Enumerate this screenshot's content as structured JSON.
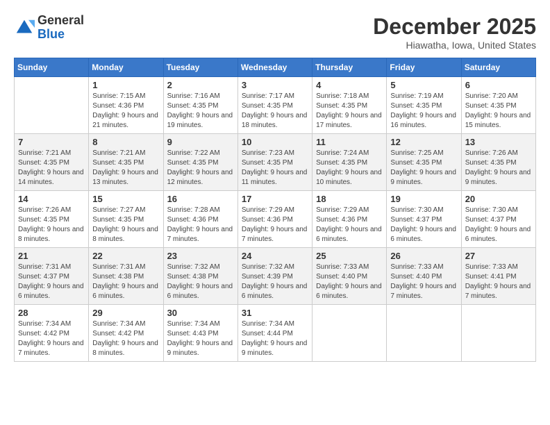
{
  "header": {
    "logo_line1": "General",
    "logo_line2": "Blue",
    "month_title": "December 2025",
    "location": "Hiawatha, Iowa, United States"
  },
  "weekdays": [
    "Sunday",
    "Monday",
    "Tuesday",
    "Wednesday",
    "Thursday",
    "Friday",
    "Saturday"
  ],
  "weeks": [
    [
      {
        "day": "",
        "sunrise": "",
        "sunset": "",
        "daylight": ""
      },
      {
        "day": "1",
        "sunrise": "Sunrise: 7:15 AM",
        "sunset": "Sunset: 4:36 PM",
        "daylight": "Daylight: 9 hours and 21 minutes."
      },
      {
        "day": "2",
        "sunrise": "Sunrise: 7:16 AM",
        "sunset": "Sunset: 4:35 PM",
        "daylight": "Daylight: 9 hours and 19 minutes."
      },
      {
        "day": "3",
        "sunrise": "Sunrise: 7:17 AM",
        "sunset": "Sunset: 4:35 PM",
        "daylight": "Daylight: 9 hours and 18 minutes."
      },
      {
        "day": "4",
        "sunrise": "Sunrise: 7:18 AM",
        "sunset": "Sunset: 4:35 PM",
        "daylight": "Daylight: 9 hours and 17 minutes."
      },
      {
        "day": "5",
        "sunrise": "Sunrise: 7:19 AM",
        "sunset": "Sunset: 4:35 PM",
        "daylight": "Daylight: 9 hours and 16 minutes."
      },
      {
        "day": "6",
        "sunrise": "Sunrise: 7:20 AM",
        "sunset": "Sunset: 4:35 PM",
        "daylight": "Daylight: 9 hours and 15 minutes."
      }
    ],
    [
      {
        "day": "7",
        "sunrise": "Sunrise: 7:21 AM",
        "sunset": "Sunset: 4:35 PM",
        "daylight": "Daylight: 9 hours and 14 minutes."
      },
      {
        "day": "8",
        "sunrise": "Sunrise: 7:21 AM",
        "sunset": "Sunset: 4:35 PM",
        "daylight": "Daylight: 9 hours and 13 minutes."
      },
      {
        "day": "9",
        "sunrise": "Sunrise: 7:22 AM",
        "sunset": "Sunset: 4:35 PM",
        "daylight": "Daylight: 9 hours and 12 minutes."
      },
      {
        "day": "10",
        "sunrise": "Sunrise: 7:23 AM",
        "sunset": "Sunset: 4:35 PM",
        "daylight": "Daylight: 9 hours and 11 minutes."
      },
      {
        "day": "11",
        "sunrise": "Sunrise: 7:24 AM",
        "sunset": "Sunset: 4:35 PM",
        "daylight": "Daylight: 9 hours and 10 minutes."
      },
      {
        "day": "12",
        "sunrise": "Sunrise: 7:25 AM",
        "sunset": "Sunset: 4:35 PM",
        "daylight": "Daylight: 9 hours and 9 minutes."
      },
      {
        "day": "13",
        "sunrise": "Sunrise: 7:26 AM",
        "sunset": "Sunset: 4:35 PM",
        "daylight": "Daylight: 9 hours and 9 minutes."
      }
    ],
    [
      {
        "day": "14",
        "sunrise": "Sunrise: 7:26 AM",
        "sunset": "Sunset: 4:35 PM",
        "daylight": "Daylight: 9 hours and 8 minutes."
      },
      {
        "day": "15",
        "sunrise": "Sunrise: 7:27 AM",
        "sunset": "Sunset: 4:35 PM",
        "daylight": "Daylight: 9 hours and 8 minutes."
      },
      {
        "day": "16",
        "sunrise": "Sunrise: 7:28 AM",
        "sunset": "Sunset: 4:36 PM",
        "daylight": "Daylight: 9 hours and 7 minutes."
      },
      {
        "day": "17",
        "sunrise": "Sunrise: 7:29 AM",
        "sunset": "Sunset: 4:36 PM",
        "daylight": "Daylight: 9 hours and 7 minutes."
      },
      {
        "day": "18",
        "sunrise": "Sunrise: 7:29 AM",
        "sunset": "Sunset: 4:36 PM",
        "daylight": "Daylight: 9 hours and 6 minutes."
      },
      {
        "day": "19",
        "sunrise": "Sunrise: 7:30 AM",
        "sunset": "Sunset: 4:37 PM",
        "daylight": "Daylight: 9 hours and 6 minutes."
      },
      {
        "day": "20",
        "sunrise": "Sunrise: 7:30 AM",
        "sunset": "Sunset: 4:37 PM",
        "daylight": "Daylight: 9 hours and 6 minutes."
      }
    ],
    [
      {
        "day": "21",
        "sunrise": "Sunrise: 7:31 AM",
        "sunset": "Sunset: 4:37 PM",
        "daylight": "Daylight: 9 hours and 6 minutes."
      },
      {
        "day": "22",
        "sunrise": "Sunrise: 7:31 AM",
        "sunset": "Sunset: 4:38 PM",
        "daylight": "Daylight: 9 hours and 6 minutes."
      },
      {
        "day": "23",
        "sunrise": "Sunrise: 7:32 AM",
        "sunset": "Sunset: 4:38 PM",
        "daylight": "Daylight: 9 hours and 6 minutes."
      },
      {
        "day": "24",
        "sunrise": "Sunrise: 7:32 AM",
        "sunset": "Sunset: 4:39 PM",
        "daylight": "Daylight: 9 hours and 6 minutes."
      },
      {
        "day": "25",
        "sunrise": "Sunrise: 7:33 AM",
        "sunset": "Sunset: 4:40 PM",
        "daylight": "Daylight: 9 hours and 6 minutes."
      },
      {
        "day": "26",
        "sunrise": "Sunrise: 7:33 AM",
        "sunset": "Sunset: 4:40 PM",
        "daylight": "Daylight: 9 hours and 7 minutes."
      },
      {
        "day": "27",
        "sunrise": "Sunrise: 7:33 AM",
        "sunset": "Sunset: 4:41 PM",
        "daylight": "Daylight: 9 hours and 7 minutes."
      }
    ],
    [
      {
        "day": "28",
        "sunrise": "Sunrise: 7:34 AM",
        "sunset": "Sunset: 4:42 PM",
        "daylight": "Daylight: 9 hours and 7 minutes."
      },
      {
        "day": "29",
        "sunrise": "Sunrise: 7:34 AM",
        "sunset": "Sunset: 4:42 PM",
        "daylight": "Daylight: 9 hours and 8 minutes."
      },
      {
        "day": "30",
        "sunrise": "Sunrise: 7:34 AM",
        "sunset": "Sunset: 4:43 PM",
        "daylight": "Daylight: 9 hours and 9 minutes."
      },
      {
        "day": "31",
        "sunrise": "Sunrise: 7:34 AM",
        "sunset": "Sunset: 4:44 PM",
        "daylight": "Daylight: 9 hours and 9 minutes."
      },
      {
        "day": "",
        "sunrise": "",
        "sunset": "",
        "daylight": ""
      },
      {
        "day": "",
        "sunrise": "",
        "sunset": "",
        "daylight": ""
      },
      {
        "day": "",
        "sunrise": "",
        "sunset": "",
        "daylight": ""
      }
    ]
  ]
}
